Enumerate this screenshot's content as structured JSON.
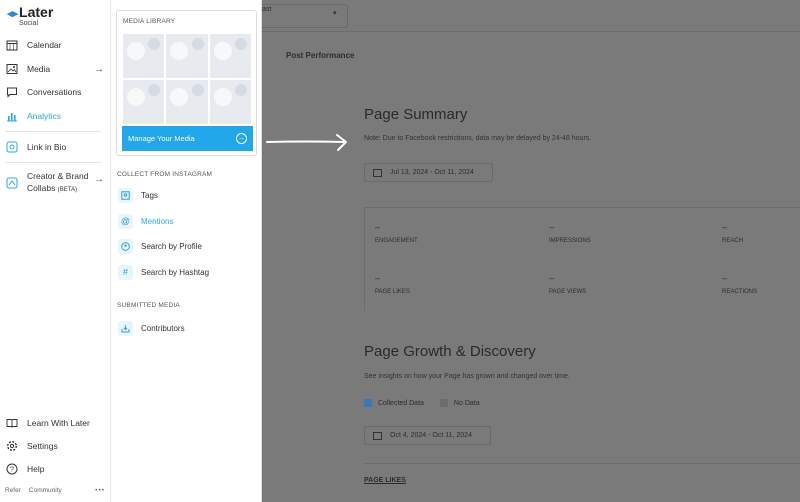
{
  "brand": {
    "name": "Later",
    "sub": "Social"
  },
  "sidebar": {
    "items": [
      {
        "label": "Calendar",
        "icon": "calendar-icon"
      },
      {
        "label": "Media",
        "icon": "media-icon",
        "chevron": "→"
      },
      {
        "label": "Conversations",
        "icon": "conversations-icon"
      },
      {
        "label": "Analytics",
        "icon": "analytics-icon",
        "active": true
      },
      {
        "label": "Link in Bio",
        "icon": "link-in-bio-icon"
      },
      {
        "label": "Creator & Brand",
        "label2": "Collabs",
        "beta": "(BETA)",
        "icon": "collabs-icon",
        "chevron": "→"
      },
      {
        "label": "Learn With Later",
        "icon": "book-icon"
      },
      {
        "label": "Settings",
        "icon": "gear-icon"
      },
      {
        "label": "Help",
        "icon": "help-icon"
      }
    ],
    "footer": {
      "refer": "Refer",
      "community": "Community",
      "more": "•••"
    }
  },
  "flyout": {
    "media_library_title": "MEDIA LIBRARY",
    "manage_button": "Manage Your Media",
    "collect_title": "COLLECT FROM INSTAGRAM",
    "collect_items": [
      {
        "label": "Tags",
        "icon": "tag-icon"
      },
      {
        "label": "Mentions",
        "icon": "at-icon",
        "active": true
      },
      {
        "label": "Search by Profile",
        "icon": "profile-search-icon"
      },
      {
        "label": "Search by Hashtag",
        "icon": "hashtag-icon"
      }
    ],
    "submitted_title": "SUBMITTED MEDIA",
    "submitted_items": [
      {
        "label": "Contributors",
        "icon": "inbox-icon"
      }
    ]
  },
  "main": {
    "select_value": "ast",
    "tab": "Post Performance",
    "page_summary": {
      "title": "Page Summary",
      "note": "Note: Due to Facebook restrictions, data may be delayed by 24-48 hours.",
      "date_range": "Jul 13, 2024 - Oct 11, 2024",
      "metrics": [
        {
          "label": "ENGAGEMENT",
          "value": "–"
        },
        {
          "label": "IMPRESSIONS",
          "value": "–"
        },
        {
          "label": "REACH",
          "value": "–"
        },
        {
          "label": "PAGE LIKES",
          "value": "–"
        },
        {
          "label": "PAGE VIEWS",
          "value": "–"
        },
        {
          "label": "REACTIONS",
          "value": "–"
        }
      ]
    },
    "growth": {
      "title": "Page Growth & Discovery",
      "description": "See insights on how your Page has grown and changed over time.",
      "legend": [
        {
          "label": "Collected Data",
          "color": "#3a79b7"
        },
        {
          "label": "No Data",
          "color": "#6d6d6d"
        }
      ],
      "date_range": "Oct 4, 2024 - Oct 11, 2024",
      "section": "PAGE LIKES"
    }
  }
}
